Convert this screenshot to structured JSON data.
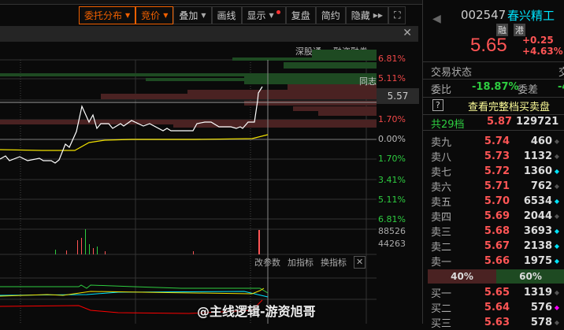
{
  "toolbar": {
    "order_dist": "委托分布",
    "auction": "竞价",
    "overlay": "叠加",
    "draw": "画线",
    "display": "显示",
    "replay": "复盘",
    "simple": "简约",
    "hide": "隐藏",
    "expand_icon": "fullscreen-icon"
  },
  "chart_tags": {
    "shgt": "深股通",
    "margin": "融资融券",
    "tongzhi": "同志"
  },
  "axis_labels": {
    "up2": "6.81%",
    "up1": "5.11%",
    "current": "5.57",
    "up0": "1.70%",
    "zero": "0.00%",
    "dn0": "1.70%",
    "dn1": "3.41%",
    "dn2": "5.11%",
    "dn3": "6.81%"
  },
  "volume_axis": {
    "max": "88526",
    "mid": "44263"
  },
  "indicator_panel": {
    "params": "改参数",
    "add": "加指标",
    "change": "换指标"
  },
  "watermark": "@主线逻辑-游资旭哥",
  "stock": {
    "code": "002547",
    "name": "春兴精工",
    "badge1": "融",
    "badge2": "港",
    "price": "5.65",
    "change": "+0.25",
    "change_pct": "+4.63%"
  },
  "status": {
    "label": "交易状态",
    "label2": "交"
  },
  "ratio": {
    "label": "委比",
    "value": "-18.87%",
    "diff_label": "委差",
    "diff_value": "-4"
  },
  "full_book": {
    "help": "?",
    "link": "查看完整档买卖盘"
  },
  "total": {
    "label": "共29档",
    "price": "5.87",
    "volume": "129721"
  },
  "asks": [
    {
      "label": "卖九",
      "price": "5.74",
      "vol": "460",
      "mark": "grey"
    },
    {
      "label": "卖八",
      "price": "5.73",
      "vol": "1132",
      "mark": "grey"
    },
    {
      "label": "卖七",
      "price": "5.72",
      "vol": "1360",
      "mark": "cyan"
    },
    {
      "label": "卖六",
      "price": "5.71",
      "vol": "762",
      "mark": "grey"
    },
    {
      "label": "卖五",
      "price": "5.70",
      "vol": "6534",
      "mark": "cyan"
    },
    {
      "label": "卖四",
      "price": "5.69",
      "vol": "2044",
      "mark": "grey"
    },
    {
      "label": "卖三",
      "price": "5.68",
      "vol": "3693",
      "mark": "cyan"
    },
    {
      "label": "卖二",
      "price": "5.67",
      "vol": "2138",
      "mark": "cyan"
    },
    {
      "label": "卖一",
      "price": "5.66",
      "vol": "1975",
      "mark": "cyan"
    }
  ],
  "split": {
    "sell_pct": "40%",
    "buy_pct": "60%"
  },
  "bids": [
    {
      "label": "买一",
      "price": "5.65",
      "vol": "1319",
      "mark": "grey"
    },
    {
      "label": "买二",
      "price": "5.64",
      "vol": "576",
      "mark": "magenta"
    },
    {
      "label": "买三",
      "price": "5.63",
      "vol": "578",
      "mark": "grey"
    }
  ],
  "colors": {
    "accent": "#f06000",
    "up": "#f04848",
    "down": "#2ecc40",
    "cyan": "#00e5ff"
  }
}
